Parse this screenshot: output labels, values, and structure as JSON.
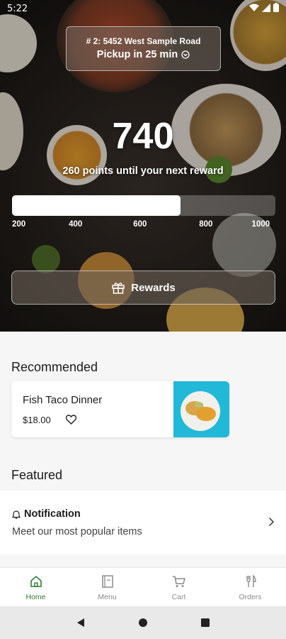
{
  "status_bar": {
    "time": "5:22"
  },
  "store": {
    "address": "# 2: 5452 West Sample Road",
    "pickup": "Pickup in 25 min"
  },
  "rewards": {
    "points": "740",
    "subtitle": "260 points until your next reward",
    "progress_fraction": 0.64,
    "ticks": [
      "200",
      "400",
      "600",
      "800",
      "1000"
    ],
    "button_label": "Rewards"
  },
  "recommended": {
    "title": "Recommended",
    "item": {
      "name": "Fish Taco Dinner",
      "price": "$18.00"
    }
  },
  "featured": {
    "title": "Featured",
    "card": {
      "title": "Notification",
      "subtitle": "Meet our most popular items"
    }
  },
  "nav": {
    "items": [
      {
        "label": "Home",
        "icon": "home-icon",
        "active": true
      },
      {
        "label": "Menu",
        "icon": "menu-book-icon",
        "active": false
      },
      {
        "label": "Cart",
        "icon": "cart-icon",
        "active": false
      },
      {
        "label": "Orders",
        "icon": "utensils-icon",
        "active": false
      }
    ]
  },
  "colors": {
    "accent": "#2e7d32",
    "thumb_bg": "#22b8d8"
  }
}
